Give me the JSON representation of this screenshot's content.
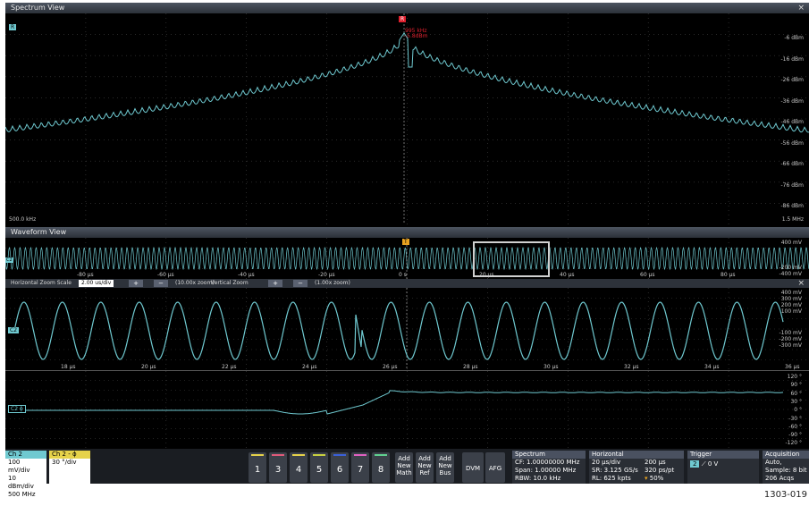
{
  "spectrum": {
    "title": "Spectrum View",
    "close": "×",
    "marker_label": "R",
    "marker_freq": "995 kHz",
    "marker_level": "-5.8dBm",
    "corner_badge": "R",
    "y_labels": [
      "-6 dBm",
      "-16 dBm",
      "-26 dBm",
      "-36 dBm",
      "-46 dBm",
      "-56 dBm",
      "-66 dBm",
      "-76 dBm",
      "-86 dBm"
    ],
    "start_freq": "500.0 kHz",
    "stop_freq": "1.5 MHz"
  },
  "waveform": {
    "title": "Waveform View",
    "close": "×",
    "trigger_marker": "T",
    "overview_badge": "C2",
    "overview_x_labels": [
      "-80 µs",
      "-60 µs",
      "-40 µs",
      "-20 µs",
      "0 s",
      "20 µs",
      "40 µs",
      "60 µs",
      "80 µs"
    ],
    "overview_y_labels": [
      "400 mV",
      "-200 mV",
      "-400 mV"
    ]
  },
  "zoom": {
    "h_label": "Horizontal Zoom Scale",
    "h_value": "2.00 us/div",
    "h_zoom": "(10.00x zoom)",
    "v_label": "Vertical Zoom",
    "v_zoom": "(1.00x zoom)",
    "plus": "+",
    "minus": "−",
    "close": "×"
  },
  "zoomed": {
    "ch2_badge": "C2",
    "y_labels": [
      "400 mV",
      "300 mV",
      "200 mV",
      "100 mV",
      "-100 mV",
      "-200 mV",
      "-300 mV"
    ],
    "x_labels": [
      "18 µs",
      "20 µs",
      "22 µs",
      "24 µs",
      "26 µs",
      "28 µs",
      "30 µs",
      "32 µs",
      "34 µs",
      "36 µs"
    ]
  },
  "phase": {
    "badge": "C2 ϕ",
    "y_labels": [
      "120 °",
      "90 °",
      "60 °",
      "30 °",
      "0 °",
      "-30 °",
      "-60 °",
      "-90 °",
      "-120 °"
    ]
  },
  "bottom": {
    "ch2": {
      "title": "Ch 2",
      "lines": [
        "100 mV/div",
        "10 dBm/div",
        "500 MHz"
      ]
    },
    "ch2phase": {
      "title": "Ch 2 - ϕ",
      "lines": [
        "30 °/div"
      ]
    },
    "channel_buttons": [
      "1",
      "3",
      "4",
      "5",
      "6",
      "7",
      "8"
    ],
    "channel_colors": [
      "#e6d24a",
      "#e05a7a",
      "#e6d24a",
      "#c8d040",
      "#3a5fd8",
      "#e060c0",
      "#60d090"
    ],
    "add_buttons": [
      [
        "Add",
        "New",
        "Math"
      ],
      [
        "Add",
        "New",
        "Ref"
      ],
      [
        "Add",
        "New",
        "Bus"
      ]
    ],
    "dvm": "DVM",
    "afg": "AFG",
    "spectrum": {
      "title": "Spectrum",
      "lines": [
        "CF: 1.00000000 MHz",
        "Span: 1.00000 MHz",
        "RBW: 10.0 kHz"
      ]
    },
    "horizontal": {
      "title": "Horizontal",
      "lines": [
        [
          "20 µs/div",
          "200 µs"
        ],
        [
          "SR: 3.125 GS/s",
          "320 ps/pt"
        ],
        [
          "RL: 625 kpts",
          "50%"
        ]
      ]
    },
    "trigger": {
      "title": "Trigger",
      "channel": "2",
      "level": "0 V"
    },
    "acquisition": {
      "title": "Acquisition",
      "lines": [
        "Auto,",
        "Sample: 8 bit",
        "206 Acqs"
      ]
    }
  },
  "figure_id": "1303-019",
  "colors": {
    "trace": "#6fc9d0",
    "marker": "#e0202e",
    "ch2": "#6fc9d0",
    "ch2phase": "#e6d24a"
  }
}
